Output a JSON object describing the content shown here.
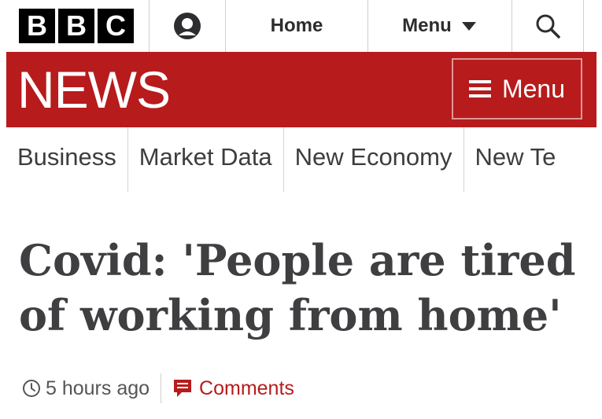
{
  "topbar": {
    "logo_letters": [
      "B",
      "B",
      "C"
    ],
    "account_icon": "account-icon",
    "home_label": "Home",
    "menu_label": "Menu",
    "menu_icon": "caret-down-icon",
    "search_icon": "search-icon"
  },
  "news_banner": {
    "wordmark": "NEWS",
    "menu_label": "Menu",
    "menu_icon": "hamburger-icon",
    "background_color": "#b71b1c"
  },
  "section_nav": {
    "items": [
      {
        "label": "Business",
        "active": true
      },
      {
        "label": "Market Data",
        "active": false
      },
      {
        "label": "New Economy",
        "active": false
      },
      {
        "label": "New Te",
        "active": false
      }
    ],
    "active_color": "#b71b1c"
  },
  "article": {
    "headline_line1": "Covid: 'People are tired",
    "headline_line2": "of working from home'",
    "timestamp": "5 hours ago",
    "timestamp_icon": "clock-icon",
    "comments_label": "Comments",
    "comments_icon": "comment-icon"
  }
}
